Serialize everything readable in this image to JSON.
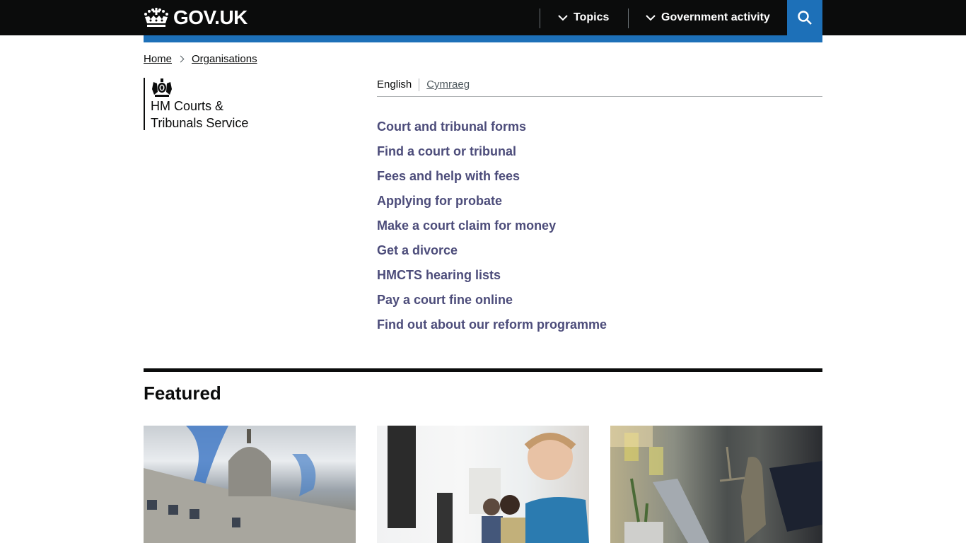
{
  "header": {
    "logo_text": "GOV.UK",
    "nav": [
      {
        "label": "Topics",
        "icon": "chevron-down-icon"
      },
      {
        "label": "Government activity",
        "icon": "chevron-down-icon"
      }
    ],
    "search_icon": "search-icon",
    "accent_color": "#1d70b8"
  },
  "breadcrumb": [
    {
      "label": "Home"
    },
    {
      "label": "Organisations"
    }
  ],
  "organisation": {
    "name_line1": "HM Courts &",
    "name_line2": "Tribunals Service",
    "crest_icon": "royal-coat-of-arms-icon"
  },
  "language": {
    "current": "English",
    "alternate": "Cymraeg"
  },
  "quick_links": [
    {
      "label": "Court and tribunal forms"
    },
    {
      "label": "Find a court or tribunal"
    },
    {
      "label": "Fees and help with fees"
    },
    {
      "label": "Applying for probate"
    },
    {
      "label": "Make a court claim for money"
    },
    {
      "label": "Get a divorce"
    },
    {
      "label": "HMCTS hearing lists"
    },
    {
      "label": "Pay a court fine online"
    },
    {
      "label": "Find out about our reform programme"
    }
  ],
  "featured": {
    "title": "Featured",
    "cards": [
      {
        "image_alt": "Court building with dome and statue"
      },
      {
        "image_alt": "Call centre staff wearing headsets"
      },
      {
        "image_alt": "Lady Justice statue on desk beside laptop"
      }
    ]
  },
  "colors": {
    "visited_link": "#4c4c7a",
    "text": "#0b0c0c"
  }
}
